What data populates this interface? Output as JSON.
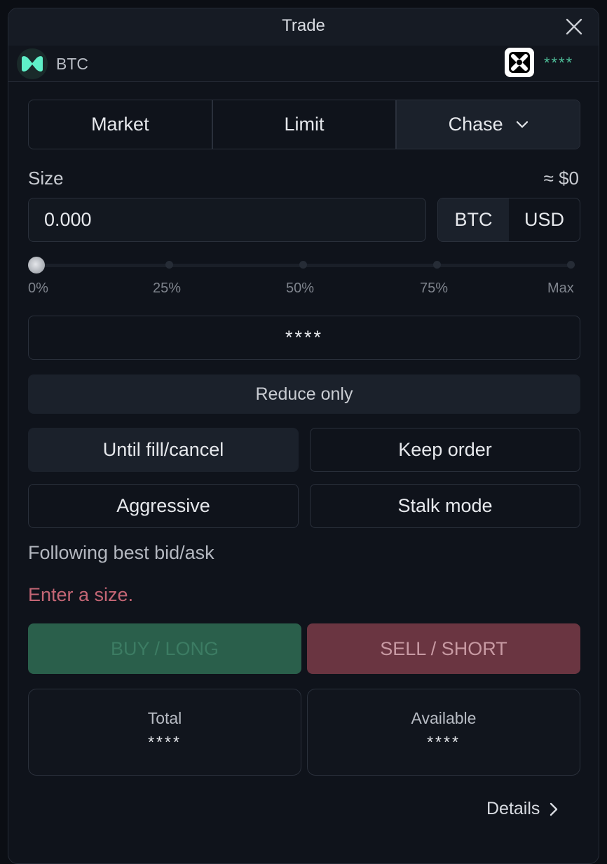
{
  "window": {
    "title": "Trade"
  },
  "asset": {
    "name": "BTC",
    "account_masked": "****",
    "asset_icon": "asset-logo-icon",
    "exchange_icon": "exchange-logo-icon"
  },
  "order_types": {
    "market": "Market",
    "limit": "Limit",
    "chase": "Chase",
    "selected": "Chase"
  },
  "size": {
    "label": "Size",
    "approx_value": "≈ $0",
    "value": "0.000",
    "unit_btc": "BTC",
    "unit_usd": "USD",
    "selected_unit": "BTC",
    "slider_fraction": 0,
    "slider_labels": [
      "0%",
      "25%",
      "50%",
      "75%",
      "Max"
    ]
  },
  "masked_field": "****",
  "reduce_only": "Reduce only",
  "options": {
    "until_fill": "Until fill/cancel",
    "keep_order": "Keep order",
    "aggressive": "Aggressive",
    "stalk_mode": "Stalk mode"
  },
  "hint": "Following best bid/ask",
  "error": "Enter a size.",
  "actions": {
    "buy": "BUY / LONG",
    "sell": "SELL / SHORT"
  },
  "stats": {
    "total_label": "Total",
    "total_value": "****",
    "available_label": "Available",
    "available_value": "****"
  },
  "details": "Details",
  "colors": {
    "buy": "#2a5f4b",
    "sell": "#6a3541",
    "accent_green": "#4fbf9a",
    "error": "#c46675"
  }
}
